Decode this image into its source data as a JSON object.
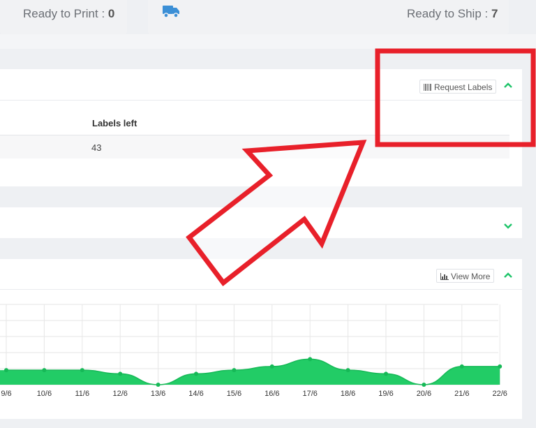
{
  "stats": {
    "ready_to_print_label": "Ready to Print : ",
    "ready_to_print_value": "0",
    "ready_to_ship_label": "Ready to Ship : ",
    "ready_to_ship_value": "7"
  },
  "icons": {
    "truck": "truck-icon",
    "barcode": "barcode-icon",
    "bar_chart": "bar-chart-icon",
    "chevron_up": "chevron-up-icon",
    "chevron_down": "chevron-down-icon"
  },
  "colors": {
    "accent_green": "#22cc66",
    "annotation_red": "#e8202a",
    "truck_blue": "#3b8fd6"
  },
  "labels_panel": {
    "request_labels": "Request Labels",
    "column_header": "Labels left",
    "rows": [
      {
        "labels_left": "43"
      }
    ]
  },
  "chart_panel": {
    "view_more": "View More"
  },
  "chart_data": {
    "type": "area",
    "title": "",
    "xlabel": "",
    "ylabel": "",
    "grid": true,
    "x": [
      "9/6",
      "10/6",
      "11/6",
      "12/6",
      "13/6",
      "14/6",
      "15/6",
      "16/6",
      "17/6",
      "18/6",
      "19/6",
      "20/6",
      "21/6",
      "22/6"
    ],
    "series": [
      {
        "values": [
          4,
          4,
          4,
          3,
          0,
          3,
          4,
          5,
          7,
          4,
          3,
          0,
          5,
          5
        ]
      }
    ],
    "ylim": [
      0,
      22
    ]
  }
}
